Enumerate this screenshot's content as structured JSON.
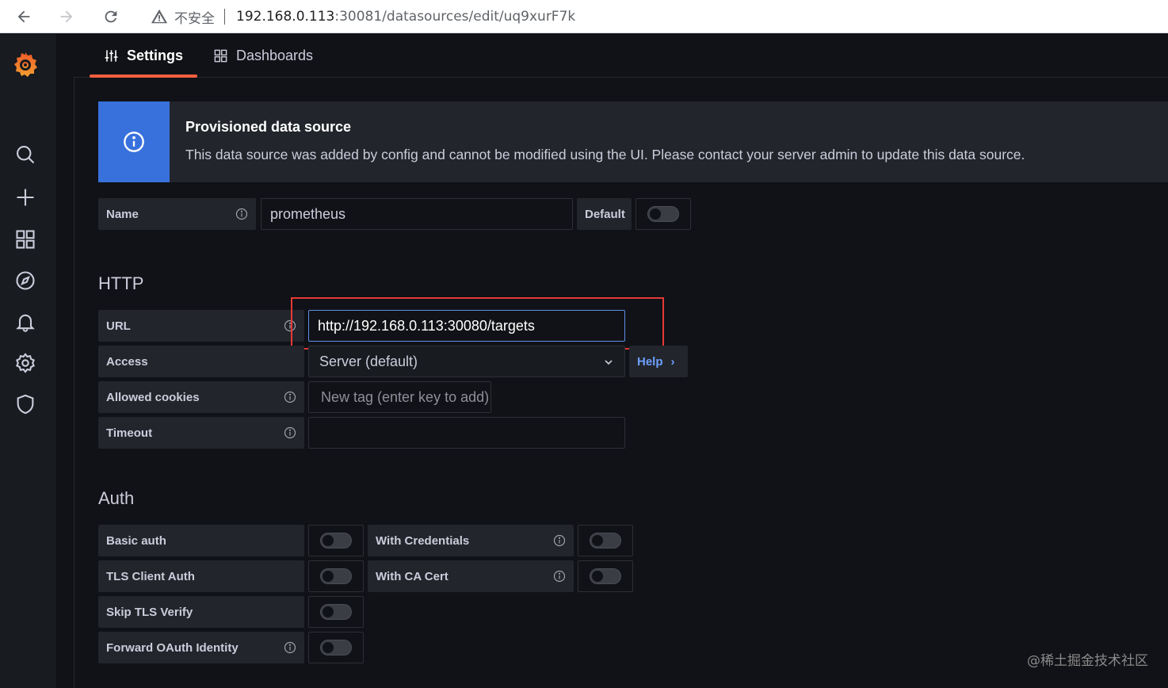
{
  "browser": {
    "insecure_label": "不安全",
    "url_host": "192.168.0.113",
    "url_rest": ":30081/datasources/edit/uq9xurF7k"
  },
  "sidebar": {
    "items": [
      "grafana-logo-icon",
      "search-icon",
      "plus-icon",
      "dashboards-icon",
      "explore-icon",
      "alerting-icon",
      "configuration-icon",
      "shield-icon"
    ]
  },
  "tabs": [
    {
      "label": "Settings",
      "icon": "sliders-icon",
      "active": true
    },
    {
      "label": "Dashboards",
      "icon": "apps-icon",
      "active": false
    }
  ],
  "alert": {
    "title": "Provisioned data source",
    "body": "This data source was added by config and cannot be modified using the UI. Please contact your server admin to update this data source."
  },
  "name_row": {
    "label": "Name",
    "value": "prometheus",
    "default_label": "Default",
    "default_on": false
  },
  "http": {
    "title": "HTTP",
    "url_label": "URL",
    "url_value": "http://192.168.0.113:30080/targets",
    "access_label": "Access",
    "access_value": "Server (default)",
    "help_label": "Help",
    "cookies_label": "Allowed cookies",
    "cookies_placeholder": "New tag (enter key to add)",
    "timeout_label": "Timeout",
    "timeout_value": ""
  },
  "auth": {
    "title": "Auth",
    "basic_auth": "Basic auth",
    "with_credentials": "With Credentials",
    "tls_client_auth": "TLS Client Auth",
    "with_ca_cert": "With CA Cert",
    "skip_tls_verify": "Skip TLS Verify",
    "forward_oauth": "Forward OAuth Identity"
  },
  "watermark": "@稀土掘金技术社区",
  "colors": {
    "accent": "#f55f3e",
    "info_blue": "#3871dc",
    "link": "#6e9fff",
    "highlight": "#e53935"
  }
}
